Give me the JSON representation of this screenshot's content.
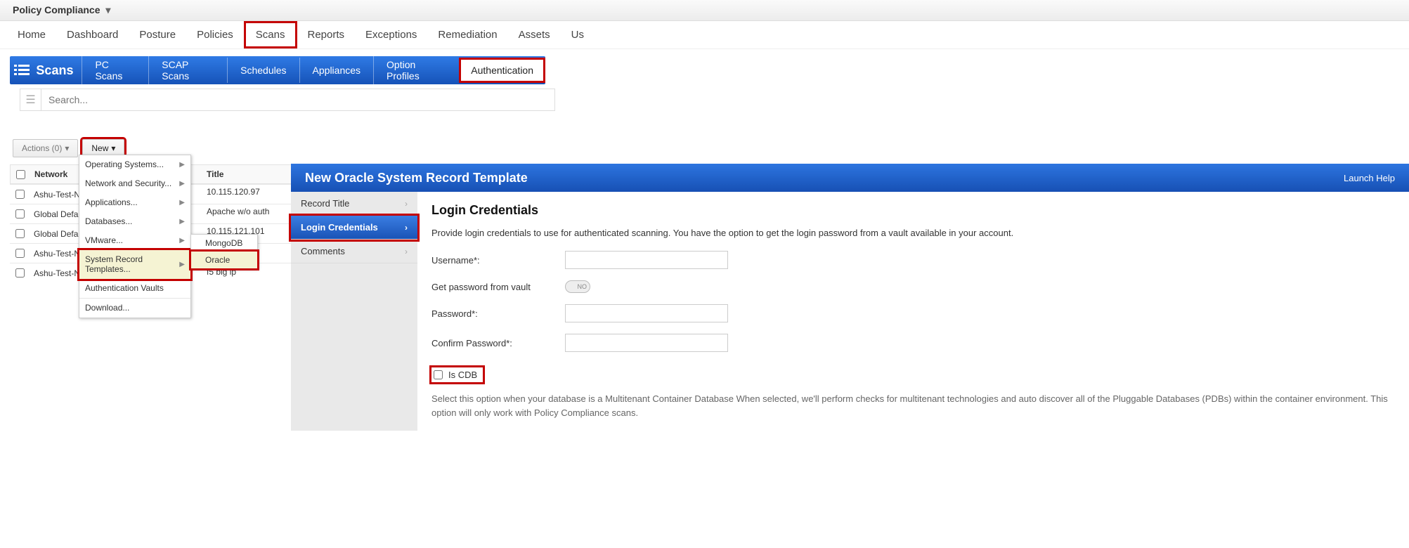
{
  "topbar": {
    "module": "Policy Compliance"
  },
  "mainnav": {
    "items": [
      "Home",
      "Dashboard",
      "Posture",
      "Policies",
      "Scans",
      "Reports",
      "Exceptions",
      "Remediation",
      "Assets",
      "Us"
    ],
    "selected": "Scans"
  },
  "subnav": {
    "title": "Scans",
    "tabs": [
      "PC Scans",
      "SCAP Scans",
      "Schedules",
      "Appliances",
      "Option Profiles",
      "Authentication"
    ],
    "selected": "Authentication"
  },
  "searchbar": {
    "placeholder": "Search..."
  },
  "toolbar": {
    "actions_label": "Actions (0)",
    "new_label": "New"
  },
  "new_menu": {
    "items": [
      {
        "label": "Operating Systems...",
        "sub": true
      },
      {
        "label": "Network and Security...",
        "sub": true
      },
      {
        "label": "Applications...",
        "sub": true
      },
      {
        "label": "Databases...",
        "sub": true
      },
      {
        "label": "VMware...",
        "sub": true
      },
      {
        "label": "System Record Templates...",
        "sub": true,
        "highlight": true
      },
      {
        "label": "Authentication Vaults",
        "sub": false
      },
      {
        "label": "Download...",
        "sub": false
      }
    ]
  },
  "srt_submenu": {
    "items": [
      {
        "label": "MongoDB"
      },
      {
        "label": "Oracle",
        "highlight": true
      }
    ]
  },
  "grid": {
    "headers": {
      "network": "Network",
      "title": "Title"
    },
    "rows": [
      {
        "network": "Ashu-Test-Net",
        "title": "10.115.120.97"
      },
      {
        "network": "Global Default",
        "title": "Apache w/o auth"
      },
      {
        "network": "Global Default",
        "title": "10.115.121.101"
      },
      {
        "network": "Ashu-Test-Net",
        "title": ""
      },
      {
        "network": "Ashu-Test-Net",
        "title": "f5 big ip"
      }
    ]
  },
  "dialog": {
    "title": "New Oracle System Record Template",
    "launch_help": "Launch Help",
    "side": [
      {
        "label": "Record Title"
      },
      {
        "label": "Login Credentials",
        "active": true
      },
      {
        "label": "Comments"
      }
    ],
    "content": {
      "heading": "Login Credentials",
      "description": "Provide login credentials to use for authenticated scanning. You have the option to get the login password from a vault available in your account.",
      "username_label": "Username*:",
      "vault_label": "Get password from vault",
      "vault_toggle": "NO",
      "password_label": "Password*:",
      "confirm_label": "Confirm Password*:",
      "cdb_label": "Is CDB",
      "cdb_help": "Select this option when your database is a Multitenant Container Database When selected, we'll perform checks for multitenant technologies and auto discover all of the Pluggable Databases (PDBs) within the container environment. This option will only work with Policy Compliance scans."
    }
  }
}
